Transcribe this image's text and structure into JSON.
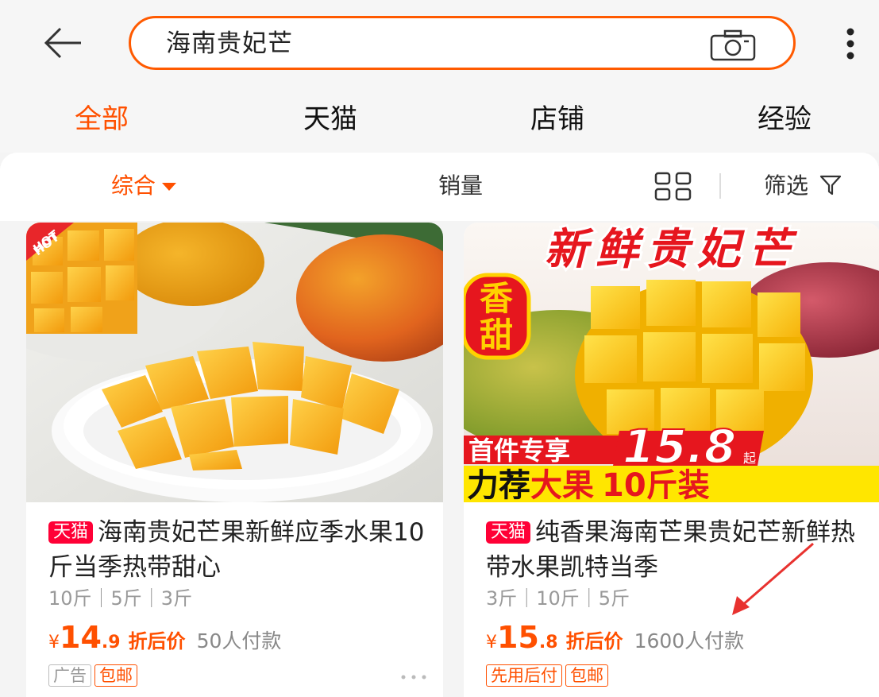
{
  "header": {
    "search_value": "海南贵妃芒",
    "back_icon": "arrow-left-icon",
    "camera_icon": "camera-icon",
    "more_icon": "more-vertical-icon"
  },
  "tabs": [
    {
      "label": "全部",
      "active": true
    },
    {
      "label": "天猫",
      "active": false
    },
    {
      "label": "店铺",
      "active": false
    },
    {
      "label": "经验",
      "active": false
    }
  ],
  "sort": {
    "comprehensive": "综合",
    "sales": "销量",
    "filter": "筛选"
  },
  "products": [
    {
      "badge": "天猫",
      "title": "海南贵妃芒果新鲜应季水果10斤当季热带甜心",
      "specs": "10斤｜5斤｜3斤",
      "currency": "¥",
      "price_int": "14",
      "price_dec": ".9",
      "price_label": "折后价",
      "buyers": "50人付款",
      "tags": [
        "广告",
        "包邮"
      ],
      "image": {
        "hot": "HOT"
      }
    },
    {
      "badge": "天猫",
      "title": "纯香果海南芒果贵妃芒新鲜热带水果凯特当季",
      "specs": "3斤｜10斤｜5斤",
      "currency": "¥",
      "price_int": "15",
      "price_dec": ".8",
      "price_label": "折后价",
      "buyers": "1600人付款",
      "tags": [
        "先用后付",
        "包邮"
      ],
      "image": {
        "headline": "新鲜贵妃芒",
        "badge_line1": "香",
        "badge_line2": "甜",
        "promo_prefix": "首件专享",
        "promo_price": "15.8",
        "promo_suffix": "起",
        "bottom_a": "力荐",
        "bottom_b": "大果",
        "bottom_c": "10斤装"
      }
    }
  ],
  "colors": {
    "accent": "#ff5000",
    "tmall_red": "#ff0036",
    "annotation_arrow": "#e8322f"
  }
}
